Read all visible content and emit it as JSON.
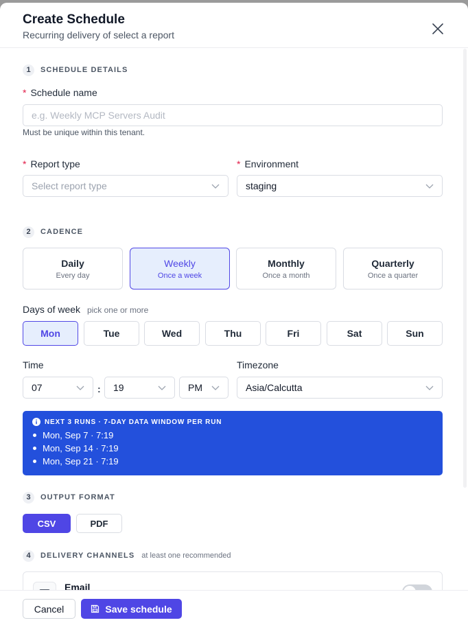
{
  "dialog": {
    "title": "Create Schedule",
    "subtitle": "Recurring delivery of select a report"
  },
  "section1": {
    "number": "1",
    "title": "SCHEDULE DETAILS",
    "name_label": "Schedule name",
    "name_placeholder": "e.g. Weekly MCP Servers Audit",
    "name_value": "",
    "name_help": "Must be unique within this tenant.",
    "report_type_label": "Report type",
    "report_type_placeholder": "Select report type",
    "environment_label": "Environment",
    "environment_value": "staging",
    "required_mark": "*"
  },
  "section2": {
    "number": "2",
    "title": "CADENCE",
    "cadences": [
      {
        "title": "Daily",
        "sub": "Every day",
        "selected": false
      },
      {
        "title": "Weekly",
        "sub": "Once a week",
        "selected": true
      },
      {
        "title": "Monthly",
        "sub": "Once a month",
        "selected": false
      },
      {
        "title": "Quarterly",
        "sub": "Once a quarter",
        "selected": false
      }
    ],
    "days_label": "Days of week",
    "days_hint": "pick one or more",
    "days": [
      {
        "label": "Mon",
        "selected": true
      },
      {
        "label": "Tue",
        "selected": false
      },
      {
        "label": "Wed",
        "selected": false
      },
      {
        "label": "Thu",
        "selected": false
      },
      {
        "label": "Fri",
        "selected": false
      },
      {
        "label": "Sat",
        "selected": false
      },
      {
        "label": "Sun",
        "selected": false
      }
    ],
    "time_label": "Time",
    "hour": "07",
    "time_separator": ":",
    "minute": "19",
    "ampm": "PM",
    "timezone_label": "Timezone",
    "timezone": "Asia/Calcutta"
  },
  "next_runs": {
    "title": "NEXT 3 RUNS · 7-DAY DATA WINDOW PER RUN",
    "runs": [
      "Mon, Sep 7 · 7:19",
      "Mon, Sep 14 · 7:19",
      "Mon, Sep 21 · 7:19"
    ]
  },
  "section3": {
    "number": "3",
    "title": "OUTPUT FORMAT",
    "formats": [
      "CSV",
      "PDF"
    ],
    "selected": "CSV"
  },
  "section4": {
    "number": "4",
    "title": "DELIVERY CHANNELS",
    "hint": "at least one recommended",
    "channels": [
      {
        "label": "Email",
        "enabled": false
      }
    ]
  },
  "footer": {
    "cancel_label": "Cancel",
    "save_label": "Save schedule"
  },
  "colors": {
    "primary": "#4f46e5",
    "selected_bg": "#e6eefd",
    "info_banner": "#2350dc",
    "required": "#e11d48"
  },
  "icons": {
    "close": "close-icon",
    "chevron": "chevron-down-icon",
    "info": "info-icon",
    "mail": "mail-icon",
    "save": "save-icon"
  }
}
